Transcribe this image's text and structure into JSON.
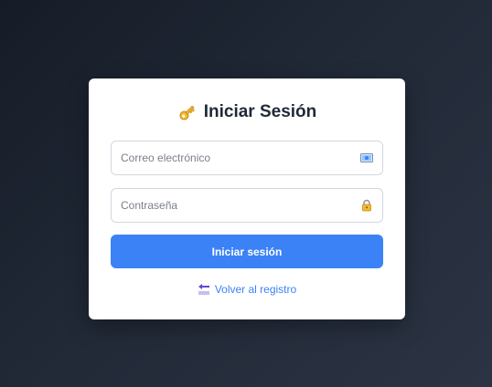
{
  "login": {
    "title": "Iniciar Sesión",
    "title_icon": "key-icon",
    "email": {
      "placeholder": "Correo electrónico",
      "value": "",
      "icon": "envelope-icon"
    },
    "password": {
      "placeholder": "Contraseña",
      "value": "",
      "icon": "lock-icon"
    },
    "submit_label": "Iniciar sesión",
    "back_link": {
      "label": "Volver al registro",
      "icon": "back-arrow-icon"
    }
  },
  "colors": {
    "accent": "#3b82f6",
    "title_text": "#1f2937",
    "background": "#1e2532",
    "card": "#ffffff"
  }
}
